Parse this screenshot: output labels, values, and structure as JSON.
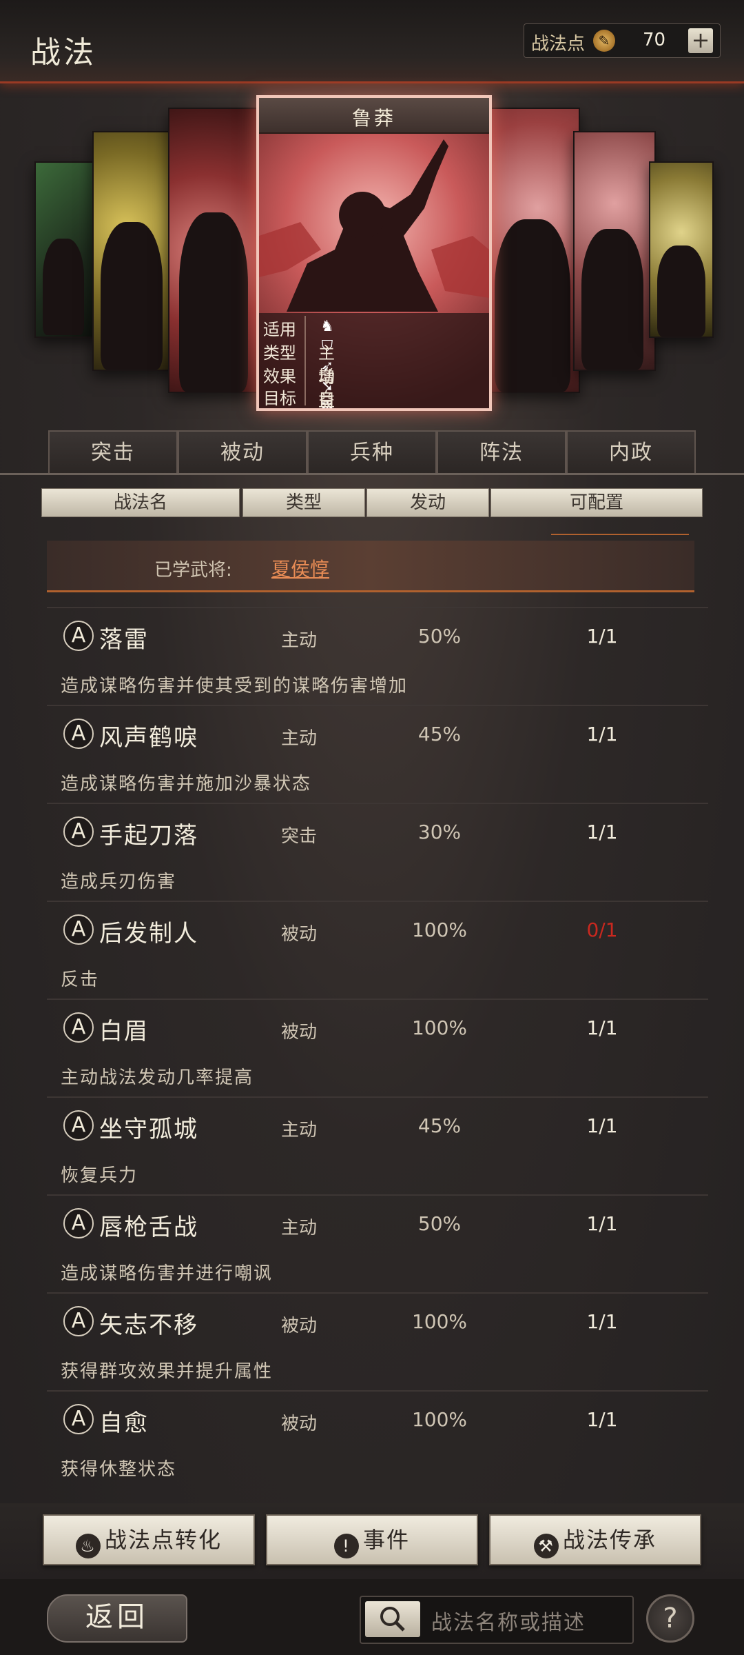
{
  "header": {
    "title": "战法",
    "points_label": "战法点",
    "points_value": "70",
    "plus_label": "+"
  },
  "featured_card": {
    "name": "鲁莽",
    "rows": [
      {
        "key": "适用",
        "value": ""
      },
      {
        "key": "类型",
        "value": "主动"
      },
      {
        "key": "效果",
        "value": "增益"
      },
      {
        "key": "目标",
        "value": "自己"
      }
    ],
    "unit_icons": [
      "cavalry-icon",
      "shield-icon",
      "bow-icon",
      "spear-icon",
      "wheel-icon"
    ]
  },
  "category_tabs": [
    "突击",
    "被动",
    "兵种",
    "阵法",
    "内政"
  ],
  "columns": [
    "战法名",
    "类型",
    "发动",
    "可配置"
  ],
  "learned": {
    "label": "已学武将:",
    "general": "夏侯惇"
  },
  "skills": [
    {
      "badge": "A",
      "name": "落雷",
      "type": "主动",
      "rate": "50%",
      "config": "1/1",
      "desc": "造成谋略伤害并使其受到的谋略伤害增加"
    },
    {
      "badge": "A",
      "name": "风声鹤唳",
      "type": "主动",
      "rate": "45%",
      "config": "1/1",
      "desc": "造成谋略伤害并施加沙暴状态"
    },
    {
      "badge": "A",
      "name": "手起刀落",
      "type": "突击",
      "rate": "30%",
      "config": "1/1",
      "desc": "造成兵刃伤害"
    },
    {
      "badge": "A",
      "name": "后发制人",
      "type": "被动",
      "rate": "100%",
      "config": "0/1",
      "desc": "反击"
    },
    {
      "badge": "A",
      "name": "白眉",
      "type": "被动",
      "rate": "100%",
      "config": "1/1",
      "desc": "主动战法发动几率提高"
    },
    {
      "badge": "A",
      "name": "坐守孤城",
      "type": "主动",
      "rate": "45%",
      "config": "1/1",
      "desc": "恢复兵力"
    },
    {
      "badge": "A",
      "name": "唇枪舌战",
      "type": "主动",
      "rate": "50%",
      "config": "1/1",
      "desc": "造成谋略伤害并进行嘲讽"
    },
    {
      "badge": "A",
      "name": "矢志不移",
      "type": "被动",
      "rate": "100%",
      "config": "1/1",
      "desc": "获得群攻效果并提升属性"
    },
    {
      "badge": "A",
      "name": "自愈",
      "type": "被动",
      "rate": "100%",
      "config": "1/1",
      "desc": "获得休整状态"
    }
  ],
  "actions": [
    {
      "label": "战法点转化",
      "icon": "flame-icon"
    },
    {
      "label": "事件",
      "icon": "scroll-icon"
    },
    {
      "label": "战法传承",
      "icon": "hammer-icon"
    }
  ],
  "footer": {
    "back_label": "返回",
    "search_placeholder": "战法名称或描述",
    "help_label": "?"
  },
  "colors": {
    "accent_orange": "#e98c55",
    "config_zero": "#c9281f",
    "header_line": "#9a3a24"
  }
}
